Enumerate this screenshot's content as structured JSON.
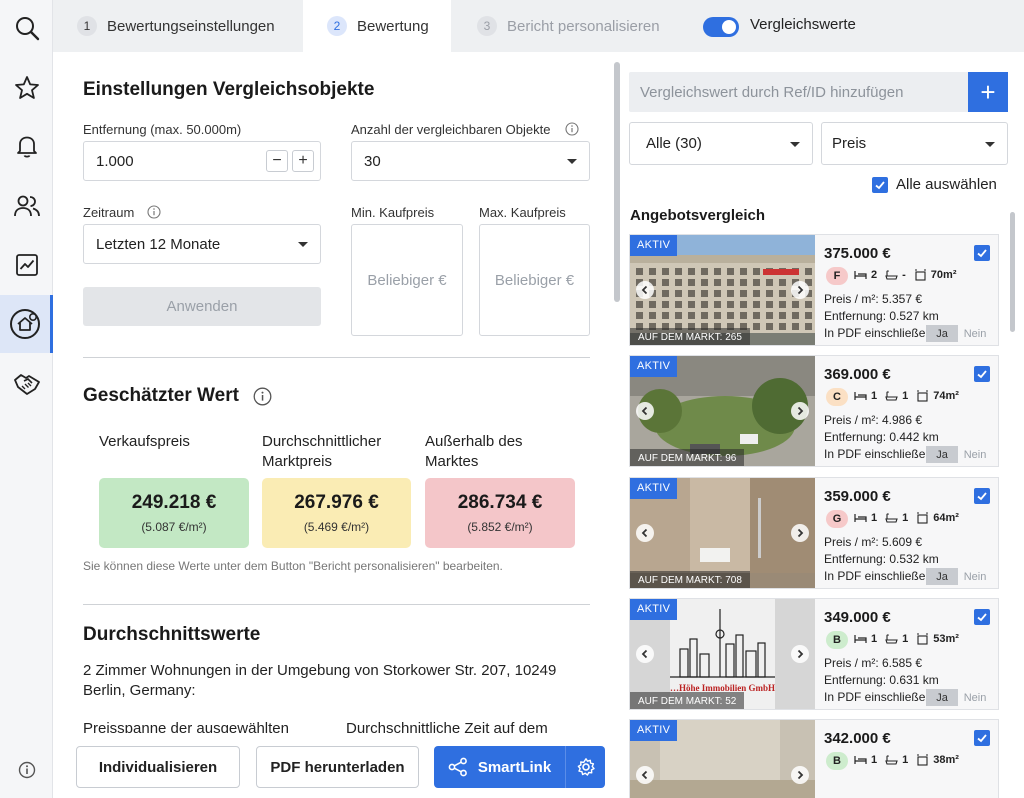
{
  "colors": {
    "accent": "#2f6fe0",
    "green_card": "#c3e8c4",
    "yellow_card": "#faecb4",
    "red_card": "#f4c6c9"
  },
  "sidebar": {
    "items": [
      {
        "icon": "search-icon"
      },
      {
        "icon": "star-icon"
      },
      {
        "icon": "bell-icon"
      },
      {
        "icon": "users-icon"
      },
      {
        "icon": "chart-icon"
      },
      {
        "icon": "home-valuation-icon",
        "active": true
      },
      {
        "icon": "handshake-icon"
      }
    ],
    "info_icon": "info-icon"
  },
  "steps": [
    {
      "num": "1",
      "label": "Bewertungseinstellungen"
    },
    {
      "num": "2",
      "label": "Bewertung"
    },
    {
      "num": "3",
      "label": "Bericht personalisieren"
    }
  ],
  "toggle": {
    "label": "Vergleichswerte",
    "on": true
  },
  "settings": {
    "title": "Einstellungen Vergleichsobjekte",
    "distance_label": "Entfernung (max. 50.000m)",
    "distance_value": "1.000",
    "count_label": "Anzahl der vergleichbaren Objekte",
    "count_value": "30",
    "period_label": "Zeitraum",
    "period_value": "Letzten 12 Monate",
    "min_label": "Min. Kaufpreis",
    "min_placeholder": "Beliebiger €",
    "max_label": "Max. Kaufpreis",
    "max_placeholder": "Beliebiger €",
    "apply": "Anwenden"
  },
  "estimate": {
    "title": "Geschätzter Wert",
    "cards": [
      {
        "label": "Verkaufspreis",
        "value": "249.218 €",
        "sub": "(5.087 €/m²)"
      },
      {
        "label": "Durchschnittlicher Marktpreis",
        "value": "267.976 €",
        "sub": "(5.469 €/m²)"
      },
      {
        "label": "Außerhalb des Marktes",
        "value": "286.734 €",
        "sub": "(5.852 €/m²)"
      }
    ],
    "hint": "Sie können diese Werte unter dem Button \"Bericht personalisieren\" bearbeiten."
  },
  "averages": {
    "title": "Durchschnittswerte",
    "desc": "2 Zimmer Wohnungen in der Umgebung von Storkower Str. 207, 10249 Berlin, Germany:",
    "col1": "Preisspanne der ausgewählten",
    "col2": "Durchschnittliche Zeit auf dem"
  },
  "bottom": {
    "customize": "Individualisieren",
    "pdf": "PDF herunterladen",
    "smartlink": "SmartLink"
  },
  "comparables": {
    "add_placeholder": "Vergleichswert durch Ref/ID hinzufügen",
    "filter_value": "Alle (30)",
    "sort_value": "Preis",
    "select_all": "Alle auswählen",
    "section_title": "Angebotsvergleich",
    "listings": [
      {
        "badge": "AKTIV",
        "market": "AUF DEM MARKT: 265",
        "price": "375.000 €",
        "energy": "F",
        "energy_color": "#f6c9c9",
        "rooms": "2",
        "baths": "-",
        "area": "70m²",
        "ppsqm": "Preis / m²: 5.357 €",
        "distance": "Entfernung: 0.527 km",
        "pdf": "In PDF einschließe",
        "yes": "Ja",
        "no": "Nein",
        "photo": "building"
      },
      {
        "badge": "AKTIV",
        "market": "AUF DEM MARKT: 96",
        "price": "369.000 €",
        "energy": "C",
        "energy_color": "#fbe0c4",
        "rooms": "1",
        "baths": "1",
        "area": "74m²",
        "ppsqm": "Preis / m²: 4.986 €",
        "distance": "Entfernung: 0.442 km",
        "pdf": "In PDF einschließe",
        "yes": "Ja",
        "no": "Nein",
        "photo": "courtyard"
      },
      {
        "badge": "AKTIV",
        "market": "AUF DEM MARKT: 708",
        "price": "359.000 €",
        "energy": "G",
        "energy_color": "#f6c9c9",
        "rooms": "1",
        "baths": "1",
        "area": "64m²",
        "ppsqm": "Preis / m²: 5.609 €",
        "distance": "Entfernung: 0.532 km",
        "pdf": "In PDF einschließe",
        "yes": "Ja",
        "no": "Nein",
        "photo": "bathroom"
      },
      {
        "badge": "AKTIV",
        "market": "AUF DEM MARKT: 52",
        "price": "349.000 €",
        "energy": "B",
        "energy_color": "#cdeccd",
        "rooms": "1",
        "baths": "1",
        "area": "53m²",
        "ppsqm": "Preis / m²: 6.585 €",
        "distance": "Entfernung: 0.631 km",
        "pdf": "In PDF einschließe",
        "yes": "Ja",
        "no": "Nein",
        "photo": "logo",
        "logo_text": "…Höhe Immobilien GmbH"
      },
      {
        "badge": "AKTIV",
        "market": "",
        "price": "342.000 €",
        "energy": "B",
        "energy_color": "#cdeccd",
        "rooms": "1",
        "baths": "1",
        "area": "38m²",
        "ppsqm": "",
        "distance": "",
        "pdf": "",
        "yes": "",
        "no": "",
        "photo": "room"
      }
    ]
  }
}
